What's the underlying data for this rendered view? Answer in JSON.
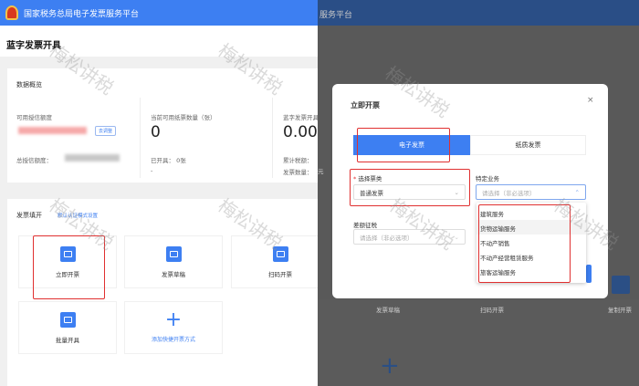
{
  "app_title": "国家税务总局电子发票服务平台",
  "right_header_fragment": "服务平台",
  "page_title": "蓝字发票开具",
  "overview": {
    "title": "数据概览",
    "credit_label": "可用授信额度",
    "adjust_button": "去调整",
    "total_credit_label": "总授信额度：",
    "paper_label": "当前可用纸票数量（张）",
    "paper_value": "0",
    "issued_label": "已开具：",
    "issued_value": "0张",
    "issued_dash": "-",
    "blue_label": "蓝字发票开具",
    "blue_value": "0.00",
    "tax_label": "累计税额：",
    "count_label": "发票数量："
  },
  "issue": {
    "title": "发票填开",
    "link": "默认认证模式设置",
    "tiles": [
      {
        "label": "立即开票",
        "icon": "invoice-icon"
      },
      {
        "label": "发票草稿",
        "icon": "draft-icon"
      },
      {
        "label": "扫码开票",
        "icon": "qr-icon"
      },
      {
        "label": "批量开具",
        "icon": "batch-icon"
      }
    ],
    "add_label": "添加快捷开票方式"
  },
  "background": {
    "tiles": [
      "发票草稿",
      "扫码开票",
      "复制开票"
    ],
    "yuan": "元"
  },
  "modal": {
    "title": "立即开票",
    "close": "×",
    "tabs": [
      "电子发票",
      "纸质发票"
    ],
    "type_label": "选择票类",
    "required": "*",
    "type_value": "普通发票",
    "special_label": "特定业务",
    "special_placeholder": "请选择（非必选项）",
    "diff_label": "差额征税",
    "diff_placeholder": "请选择（非必选项）",
    "options": [
      "建筑服务",
      "货物运输服务",
      "不动产销售",
      "不动产经营租赁服务",
      "旅客运输服务"
    ]
  },
  "watermark": "梅松讲税",
  "colors": {
    "brand": "#3d7ff2",
    "highlight": "#e03030"
  }
}
